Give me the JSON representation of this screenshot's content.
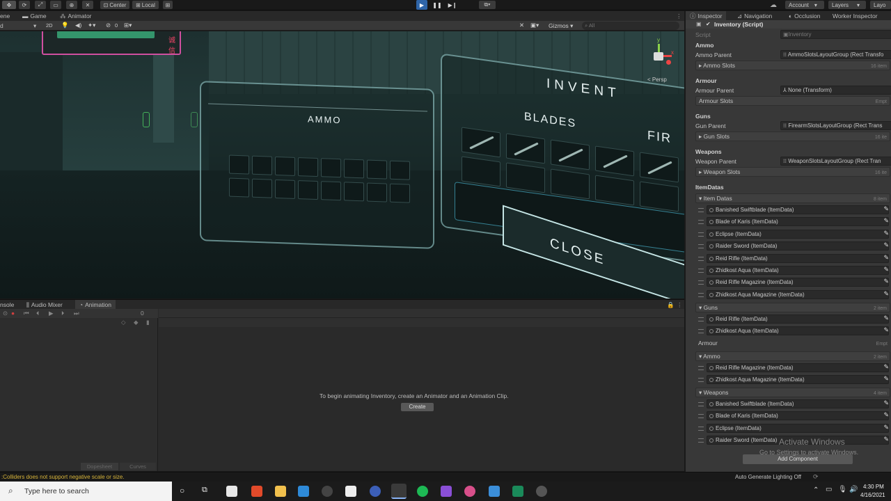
{
  "toolbar": {
    "pivot_center": "Center",
    "pivot_local": "Local",
    "account": "Account",
    "layers": "Layers",
    "layout": "Layo"
  },
  "scene_tabs": [
    "ene",
    "Game",
    "Animator"
  ],
  "scene_toolbar": {
    "mode_2d": "2D",
    "gizmos": "Gizmos",
    "search_placeholder": "All",
    "camera_count": "0",
    "persp": "< Persp"
  },
  "scene": {
    "sign_text": "诚信",
    "ammo_label": "AMMO",
    "blades_label": "BLADES",
    "inventory_label": "INVENT",
    "fire_label": "FIR",
    "close_label": "CLOSE",
    "gizmo_y": "y",
    "gizmo_x": "x"
  },
  "anim_tabs": [
    "nsole",
    "Audio Mixer",
    "Animation"
  ],
  "animation": {
    "frame": "0",
    "message": "To begin animating Inventory, create an Animator and an Animation Clip.",
    "create_button": "Create",
    "dopesheet": "Dopesheet",
    "curves": "Curves"
  },
  "status": {
    "warning": ":Colliders does not support negative scale or size.",
    "lighting": "Auto Generate Lighting Off"
  },
  "inspector": {
    "tabs": [
      "Inspector",
      "Navigation",
      "Occlusion",
      "Worker Inspector"
    ],
    "component_title": "Inventory (Script)",
    "script_label": "Script",
    "script_value": "Inventory",
    "sections": {
      "ammo": {
        "header": "Ammo",
        "parent_label": "Ammo Parent",
        "parent_value": "AmmoSlotsLayoutGroup (Rect Transfo",
        "slots_label": "Ammo Slots",
        "slots_count": "16 item"
      },
      "armour": {
        "header": "Armour",
        "parent_label": "Armour Parent",
        "parent_value": "None (Transform)",
        "slots_label": "Armour Slots",
        "slots_count": "Empt"
      },
      "gun": {
        "header": "Guns",
        "parent_label": "Gun Parent",
        "parent_value": "FirearmSlotsLayoutGroup (Rect Trans",
        "slots_label": "Gun Slots",
        "slots_count": "16 ite"
      },
      "weapons": {
        "header": "Weapons",
        "parent_label": "Weapon Parent",
        "parent_value": "WeaponSlotsLayoutGroup (Rect Tran",
        "slots_label": "Weapon Slots",
        "slots_count": "16 ite"
      }
    },
    "itemdatas_header": "ItemDatas",
    "item_datas": {
      "label": "Item Datas",
      "count": "8 item",
      "items": [
        "Banished Swiftblade (ItemData)",
        "Blade of Karis (ItemData)",
        "Eclipse (ItemData)",
        "Raider Sword (ItemData)",
        "Reid Rifle (ItemData)",
        "Zhidkost Aqua (ItemData)",
        "Reid Rifle Magazine (ItemData)",
        "Zhidkost Aqua Magazine (ItemData)"
      ]
    },
    "guns": {
      "label": "Guns",
      "count": "2 item",
      "items": [
        "Reid Rifle (ItemData)",
        "Zhidkost Aqua (ItemData)"
      ]
    },
    "armour": {
      "label": "Armour",
      "count": "Empt"
    },
    "ammo": {
      "label": "Ammo",
      "count": "2 item",
      "items": [
        "Reid Rifle Magazine (ItemData)",
        "Zhidkost Aqua Magazine (ItemData)"
      ]
    },
    "weapons": {
      "label": "Weapons",
      "count": "4 item",
      "items": [
        "Banished Swiftblade (ItemData)",
        "Blade of Karis (ItemData)",
        "Eclipse (ItemData)",
        "Raider Sword (ItemData)"
      ]
    },
    "add_component": "Add Component",
    "watermark_title": "Activate Windows",
    "watermark_sub": "Go to Settings to activate Windows."
  },
  "taskbar": {
    "search_placeholder": "Type here to search",
    "time": "4:30 PM",
    "date": "4/16/2021"
  },
  "colors": {
    "accent": "#3a79bb",
    "play_blue": "#2f65a8",
    "warning_yellow": "#d7b43a"
  }
}
